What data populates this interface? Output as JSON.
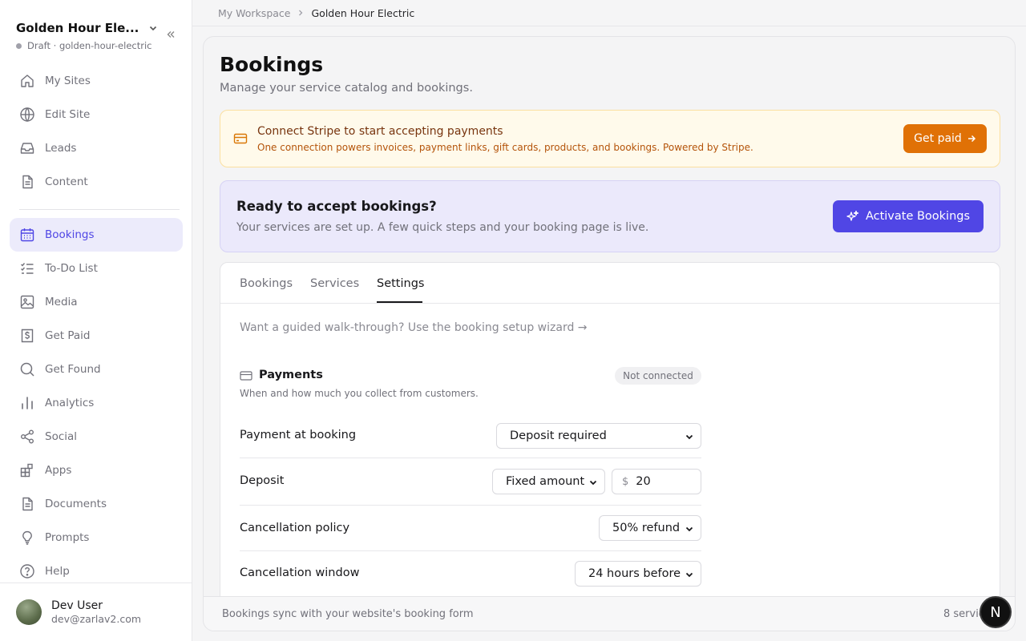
{
  "site": {
    "title": "Golden Hour Ele...",
    "status": "Draft · golden-hour-electric"
  },
  "sidebar": {
    "items": [
      {
        "label": "My Sites",
        "icon": "home-icon"
      },
      {
        "label": "Edit Site",
        "icon": "globe-icon"
      },
      {
        "label": "Leads",
        "icon": "inbox-icon"
      },
      {
        "label": "Content",
        "icon": "document-icon"
      },
      {
        "label": "Bookings",
        "icon": "calendar-icon",
        "active": true
      },
      {
        "label": "To-Do List",
        "icon": "checklist-icon"
      },
      {
        "label": "Media",
        "icon": "image-icon"
      },
      {
        "label": "Get Paid",
        "icon": "receipt-dollar-icon"
      },
      {
        "label": "Get Found",
        "icon": "search-icon"
      },
      {
        "label": "Analytics",
        "icon": "bar-chart-icon"
      },
      {
        "label": "Social",
        "icon": "share-icon"
      },
      {
        "label": "Apps",
        "icon": "apps-icon"
      },
      {
        "label": "Documents",
        "icon": "document-icon"
      },
      {
        "label": "Prompts",
        "icon": "lightbulb-icon"
      },
      {
        "label": "Help",
        "icon": "help-circle-icon"
      }
    ]
  },
  "user": {
    "name": "Dev User",
    "email": "dev@zarlav2.com"
  },
  "breadcrumb": {
    "root": "My Workspace",
    "current": "Golden Hour Electric"
  },
  "page": {
    "title": "Bookings",
    "subtitle": "Manage your service catalog and bookings."
  },
  "stripe_banner": {
    "title": "Connect Stripe to start accepting payments",
    "description": "One connection powers invoices, payment links, gift cards, products, and bookings. Powered by Stripe.",
    "button": "Get paid"
  },
  "ready_banner": {
    "title": "Ready to accept bookings?",
    "description": "Your services are set up. A few quick steps and your booking page is live.",
    "button": "Activate Bookings"
  },
  "tabs": [
    {
      "label": "Bookings"
    },
    {
      "label": "Services"
    },
    {
      "label": "Settings",
      "active": true
    }
  ],
  "settings": {
    "wizard_link": "Want a guided walk-through? Use the booking setup wizard →",
    "payments": {
      "title": "Payments",
      "badge": "Not connected",
      "description": "When and how much you collect from customers.",
      "payment_at_booking": {
        "label": "Payment at booking",
        "value": "Deposit required"
      },
      "deposit": {
        "label": "Deposit",
        "type": "Fixed amount",
        "currency": "$",
        "amount": "20"
      },
      "cancellation_policy": {
        "label": "Cancellation policy",
        "value": "50% refund"
      },
      "cancellation_window": {
        "label": "Cancellation window",
        "value": "24 hours before"
      }
    }
  },
  "footer": {
    "left": "Bookings sync with your website's booking form",
    "right": "8 servic"
  },
  "floating_badge": "N",
  "colors": {
    "accent": "#5046e5",
    "stripe_button": "#e07106",
    "active_nav_bg": "#ecebfb"
  }
}
